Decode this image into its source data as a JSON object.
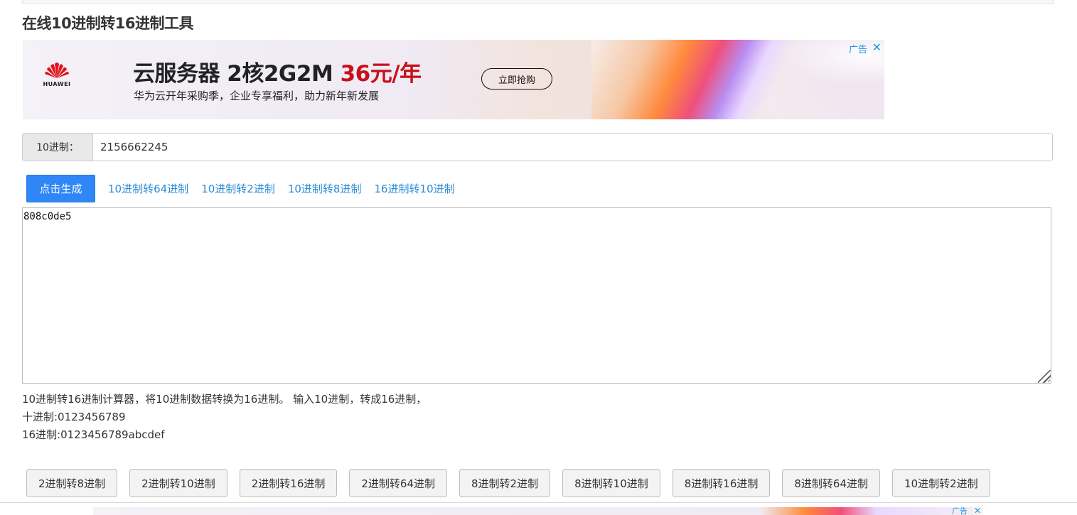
{
  "page": {
    "title": "在线10进制转16进制工具"
  },
  "ad": {
    "brand": "HUAWEI",
    "headline_main": "云服务器 2核2G2M ",
    "headline_price": "36元/年",
    "subline": "华为云开年采购季，企业专享福利，助力新年新发展",
    "cta": "立即抢购",
    "label": "广告",
    "close_icon": "close-icon",
    "accent_color": "#c8101a"
  },
  "input": {
    "addon_label": "10进制：",
    "value": "2156662245"
  },
  "actions": {
    "generate_label": "点击生成",
    "primary_color": "#2f86f6",
    "links": [
      {
        "label": "10进制转64进制"
      },
      {
        "label": "10进制转2进制"
      },
      {
        "label": "10进制转8进制"
      },
      {
        "label": "16进制转10进制"
      }
    ]
  },
  "result": {
    "value": "808c0de5"
  },
  "description": {
    "line1": "10进制转16进制计算器，将10进制数据转换为16进制。 输入10进制，转成16进制，",
    "line2": "十进制:0123456789",
    "line3": "16进制:0123456789abcdef"
  },
  "tools": [
    {
      "label": "2进制转8进制"
    },
    {
      "label": "2进制转10进制"
    },
    {
      "label": "2进制转16进制"
    },
    {
      "label": "2进制转64进制"
    },
    {
      "label": "8进制转2进制"
    },
    {
      "label": "8进制转10进制"
    },
    {
      "label": "8进制转16进制"
    },
    {
      "label": "8进制转64进制"
    },
    {
      "label": "10进制转2进制"
    }
  ],
  "bottom_ad": {
    "label": "广告"
  }
}
